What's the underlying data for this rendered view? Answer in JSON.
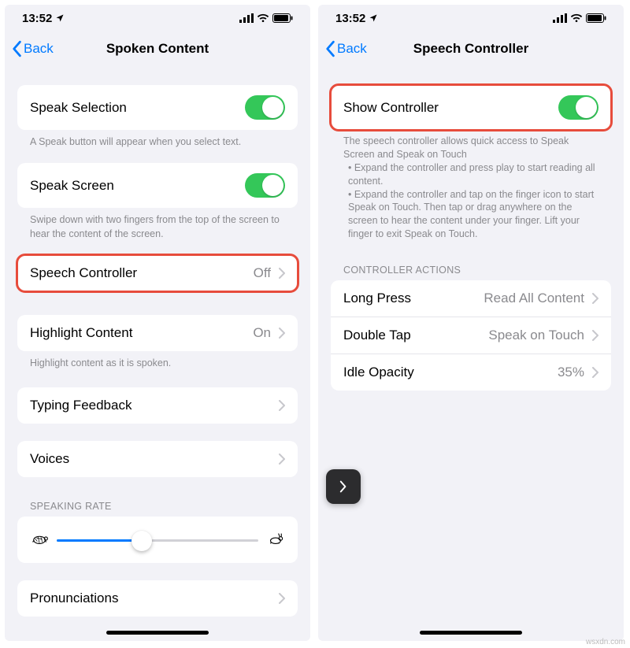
{
  "status": {
    "time": "13:52"
  },
  "left": {
    "back": "Back",
    "title": "Spoken Content",
    "speak_selection": {
      "label": "Speak Selection",
      "footer": "A Speak button will appear when you select text."
    },
    "speak_screen": {
      "label": "Speak Screen",
      "footer": "Swipe down with two fingers from the top of the screen to hear the content of the screen."
    },
    "speech_controller": {
      "label": "Speech Controller",
      "value": "Off"
    },
    "highlight": {
      "label": "Highlight Content",
      "value": "On",
      "footer": "Highlight content as it is spoken."
    },
    "typing_feedback": {
      "label": "Typing Feedback"
    },
    "voices": {
      "label": "Voices"
    },
    "rate_header": "SPEAKING RATE",
    "pronunciations": {
      "label": "Pronunciations"
    }
  },
  "right": {
    "back": "Back",
    "title": "Speech Controller",
    "show_controller": {
      "label": "Show Controller"
    },
    "desc_line1": "The speech controller allows quick access to Speak Screen and Speak on Touch",
    "desc_line2": "• Expand the controller and press play to start reading all content.",
    "desc_line3": "• Expand the controller and tap on the finger icon to start Speak on Touch. Then tap or drag anywhere on the screen to hear the content under your finger. Lift your finger to exit Speak on Touch.",
    "actions_header": "CONTROLLER ACTIONS",
    "long_press": {
      "label": "Long Press",
      "value": "Read All Content"
    },
    "double_tap": {
      "label": "Double Tap",
      "value": "Speak on Touch"
    },
    "idle_opacity": {
      "label": "Idle Opacity",
      "value": "35%"
    }
  },
  "watermark": "wsxdn.com"
}
